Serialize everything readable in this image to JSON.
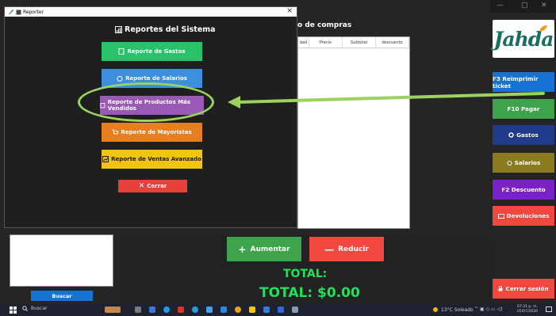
{
  "dialog": {
    "title": "Reporter",
    "close": "×",
    "heading": "Reportes del Sistema",
    "buttons": [
      {
        "label": "Reporte de Gastos",
        "color": "#27c26a"
      },
      {
        "label": "Reporte de Salarios",
        "color": "#3b8fdc"
      },
      {
        "label": "Reporte de Productos Más Vendidos",
        "color": "#9b59b6"
      },
      {
        "label": "Reporte de Mayoristas",
        "color": "#e67e22"
      },
      {
        "label": "Reporte de Ventas Avanzado",
        "color": "#f1c40f"
      }
    ],
    "close_button": "Cerrar"
  },
  "sales": {
    "title": "o de compras",
    "columns": [
      "dad",
      "Precio",
      "Subtotal",
      "descuento"
    ]
  },
  "sidebar": {
    "logo": "Jahda",
    "buttons": [
      {
        "label": "F3 Reimprimir ticket",
        "color": "#1673d6"
      },
      {
        "label": "F10 Pagar",
        "color": "#3fa34d"
      },
      {
        "label": "Gastos",
        "color": "#1f3b8a"
      },
      {
        "label": "Salarios",
        "color": "#8a7b1f"
      },
      {
        "label": "F2 Descuento",
        "color": "#7a22c8"
      },
      {
        "label": "Devoluciones",
        "color": "#f0483e"
      }
    ],
    "logout": {
      "label": "Cerrar sesión",
      "color": "#f0483e"
    }
  },
  "main": {
    "buscar": "Buscar",
    "aumentar": "Aumentar",
    "reducir": "Reducir",
    "total_label": "TOTAL:",
    "total_value": "TOTAL: $0.00"
  },
  "window_controls": {
    "minimize": "—",
    "maximize": "▢",
    "close": "✕"
  },
  "taskbar": {
    "search": "Buscar",
    "weather": "13°C Soleado",
    "time": "07:31 p. m.",
    "date": "05/07/2026"
  }
}
